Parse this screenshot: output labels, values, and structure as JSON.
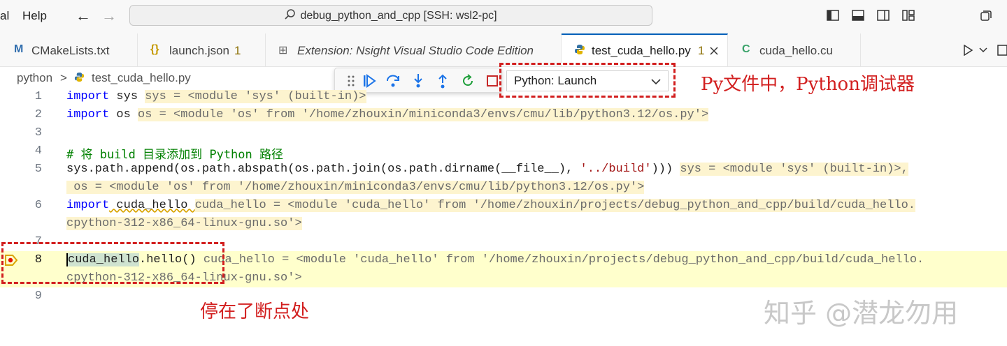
{
  "titlebar": {
    "menu_partial": "al",
    "menu_help": "Help",
    "back_arrow": "←",
    "forward_arrow": "→",
    "command_center": "debug_python_and_cpp [SSH: wsl2-pc]"
  },
  "tabs": [
    {
      "icon": "M",
      "label": "CMakeLists.txt",
      "badge": ""
    },
    {
      "icon": "{}",
      "label": "launch.json",
      "badge": "1"
    },
    {
      "icon": "⊞",
      "label": "Extension: Nsight Visual Studio Code Edition",
      "badge": ""
    },
    {
      "icon": "py",
      "label": "test_cuda_hello.py",
      "badge": "1"
    },
    {
      "icon": "C",
      "label": "cuda_hello.cu",
      "badge": ""
    }
  ],
  "breadcrumb": {
    "folder": "python",
    "sep": ">",
    "file": "test_cuda_hello.py"
  },
  "debug": {
    "config": "Python: Launch"
  },
  "annotations": {
    "top": "Py文件中，Python调试器",
    "bottom": "停在了断点处"
  },
  "lines": {
    "n1": "1",
    "n2": "2",
    "n3": "3",
    "n4": "4",
    "n5": "5",
    "n6": "6",
    "n7": "7",
    "n8": "8",
    "n9": "9",
    "l1_kw": "import",
    "l1_mod": " sys ",
    "l1_inl": "sys = <module 'sys' (built-in)>",
    "l2_kw": "import",
    "l2_mod": " os ",
    "l2_inl": "os = <module 'os' from '/home/zhouxin/miniconda3/envs/cmu/lib/python3.12/os.py'>",
    "l4": "# 将 build 目录添加到 Python 路径",
    "l5_code": "sys.path.append(os.path.abspath(os.path.join(os.path.dirname(__file__), ",
    "l5_str": "'../build'",
    "l5_end": "))) ",
    "l5_inl": "sys = <module 'sys' (built-in)>,",
    "l5b_inl": " os = <module 'os' from '/home/zhouxin/miniconda3/envs/cmu/lib/python3.12/os.py'>",
    "l6_kw": "import",
    "l6_mod": " cuda_hello ",
    "l6_inl": "cuda_hello = <module 'cuda_hello' from '/home/zhouxin/projects/debug_python_and_cpp/build/cuda_hello.",
    "l6b_inl": "cpython-312-x86_64-linux-gnu.so'>",
    "l8_obj": "cuda_hello",
    "l8_call": ".hello() ",
    "l8_inl": "cuda_hello = <module 'cuda_hello' from '/home/zhouxin/projects/debug_python_and_cpp/build/cuda_hello.",
    "l8b_inl": "cpython-312-x86_64-linux-gnu.so'>"
  },
  "watermark": "知乎 @潜龙勿用",
  "colors": {
    "accent": "#005fb8",
    "annotation": "#d21f1f",
    "current_line": "#ffffcc"
  }
}
